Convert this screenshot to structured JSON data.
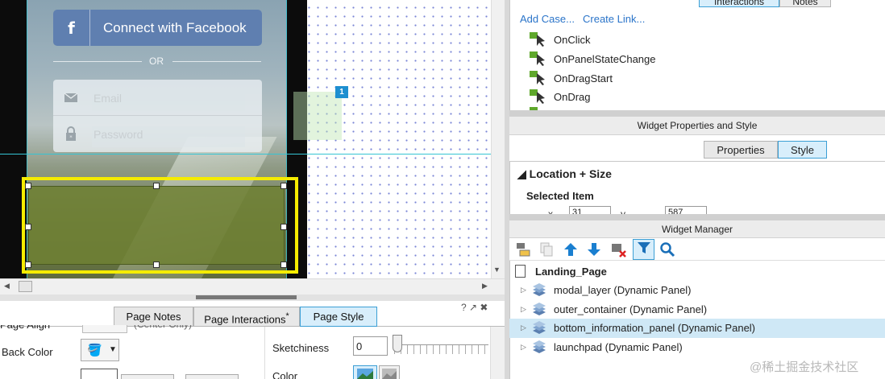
{
  "canvas": {
    "facebook_button": "Connect with Facebook",
    "facebook_glyph": "f",
    "or_divider": "OR",
    "email_placeholder": "Email",
    "password_placeholder": "Password",
    "footnote_badge": "1",
    "accent_selection": "#f5ec00",
    "accent_guide": "#35c4d4"
  },
  "bottom_panel": {
    "tabs": [
      {
        "label": "Page Notes"
      },
      {
        "label": "Page Interactions"
      },
      {
        "label": "Page Style",
        "active": true
      }
    ],
    "interactions_modified_marker": "*",
    "tools": "? ↗ ✖",
    "page_align_label": "Page Align",
    "page_align_hint": "(Center Only)",
    "back_color_label": "Back Color",
    "sketchiness_label": "Sketchiness",
    "sketchiness_value": "0",
    "color_label": "Color"
  },
  "right_panel": {
    "top_tabs": [
      {
        "label": "Interactions",
        "active": true
      },
      {
        "label": "Notes"
      }
    ],
    "add_case": "Add Case...",
    "create_link": "Create Link...",
    "events": [
      {
        "label": "OnClick"
      },
      {
        "label": "OnPanelStateChange"
      },
      {
        "label": "OnDragStart"
      },
      {
        "label": "OnDrag"
      }
    ],
    "widget_props_header": "Widget Properties and Style",
    "props_tabs": [
      {
        "label": "Properties"
      },
      {
        "label": "Style",
        "active": true
      }
    ],
    "location_size": "Location + Size",
    "selected_item": "Selected Item",
    "x_label": "x",
    "x_value": "31",
    "y_label": "y",
    "y_value": "587",
    "widget_manager_header": "Widget Manager",
    "toolbar_icons": [
      "add-master-icon",
      "copy-icon",
      "move-up-icon",
      "move-down-icon",
      "delete-icon",
      "filter-icon",
      "search-icon"
    ],
    "tree_root": "Landing_Page",
    "tree_items": [
      {
        "label": "modal_layer (Dynamic Panel)"
      },
      {
        "label": "outer_container (Dynamic Panel)"
      },
      {
        "label": "bottom_information_panel (Dynamic Panel)",
        "selected": true
      },
      {
        "label": "launchpad (Dynamic Panel)"
      }
    ],
    "watermark": "@稀土掘金技术社区"
  }
}
